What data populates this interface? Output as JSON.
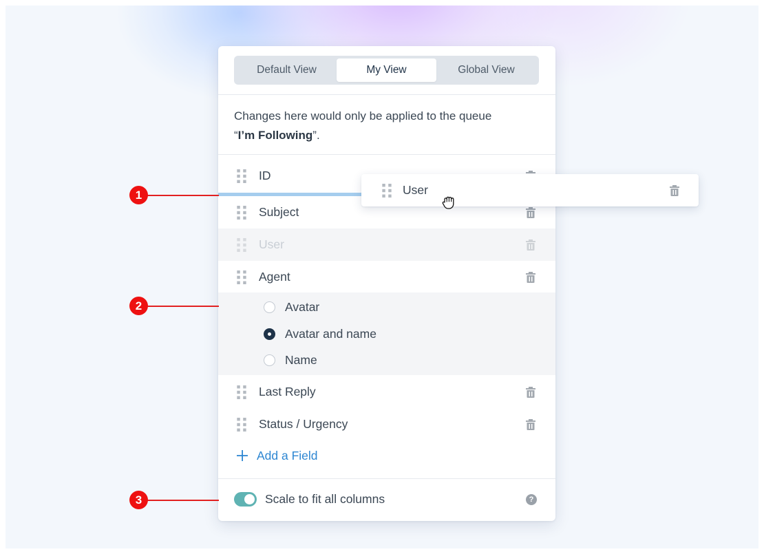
{
  "tabs": [
    {
      "label": "Default View"
    },
    {
      "label": "My View",
      "active": true
    },
    {
      "label": "Global View"
    }
  ],
  "description": {
    "line1": "Changes here would only be applied to the queue",
    "quote_open": "“",
    "queue_name": "I’m Following",
    "quote_close": "”."
  },
  "fields": [
    {
      "label": "ID"
    },
    {
      "label": "Subject"
    },
    {
      "label": "User",
      "state": "placeholder"
    },
    {
      "label": "Agent"
    },
    {
      "label": "Last Reply"
    },
    {
      "label": "Status / Urgency"
    }
  ],
  "agent_options": [
    {
      "label": "Avatar",
      "selected": false
    },
    {
      "label": "Avatar and name",
      "selected": true
    },
    {
      "label": "Name",
      "selected": false
    }
  ],
  "add_field": {
    "label": "Add a Field",
    "icon": "plus-icon"
  },
  "footer": {
    "toggle_label": "Scale to fit all columns",
    "toggle_on": true,
    "help_glyph": "?"
  },
  "dragging": {
    "label": "User"
  },
  "callouts": [
    "1",
    "2",
    "3"
  ],
  "colors": {
    "accent": "#2d86d2",
    "toggle": "#5fb3b3",
    "callout": "#ee1111",
    "selected_radio": "#1e3349",
    "insert_line": "#a5cdee"
  }
}
